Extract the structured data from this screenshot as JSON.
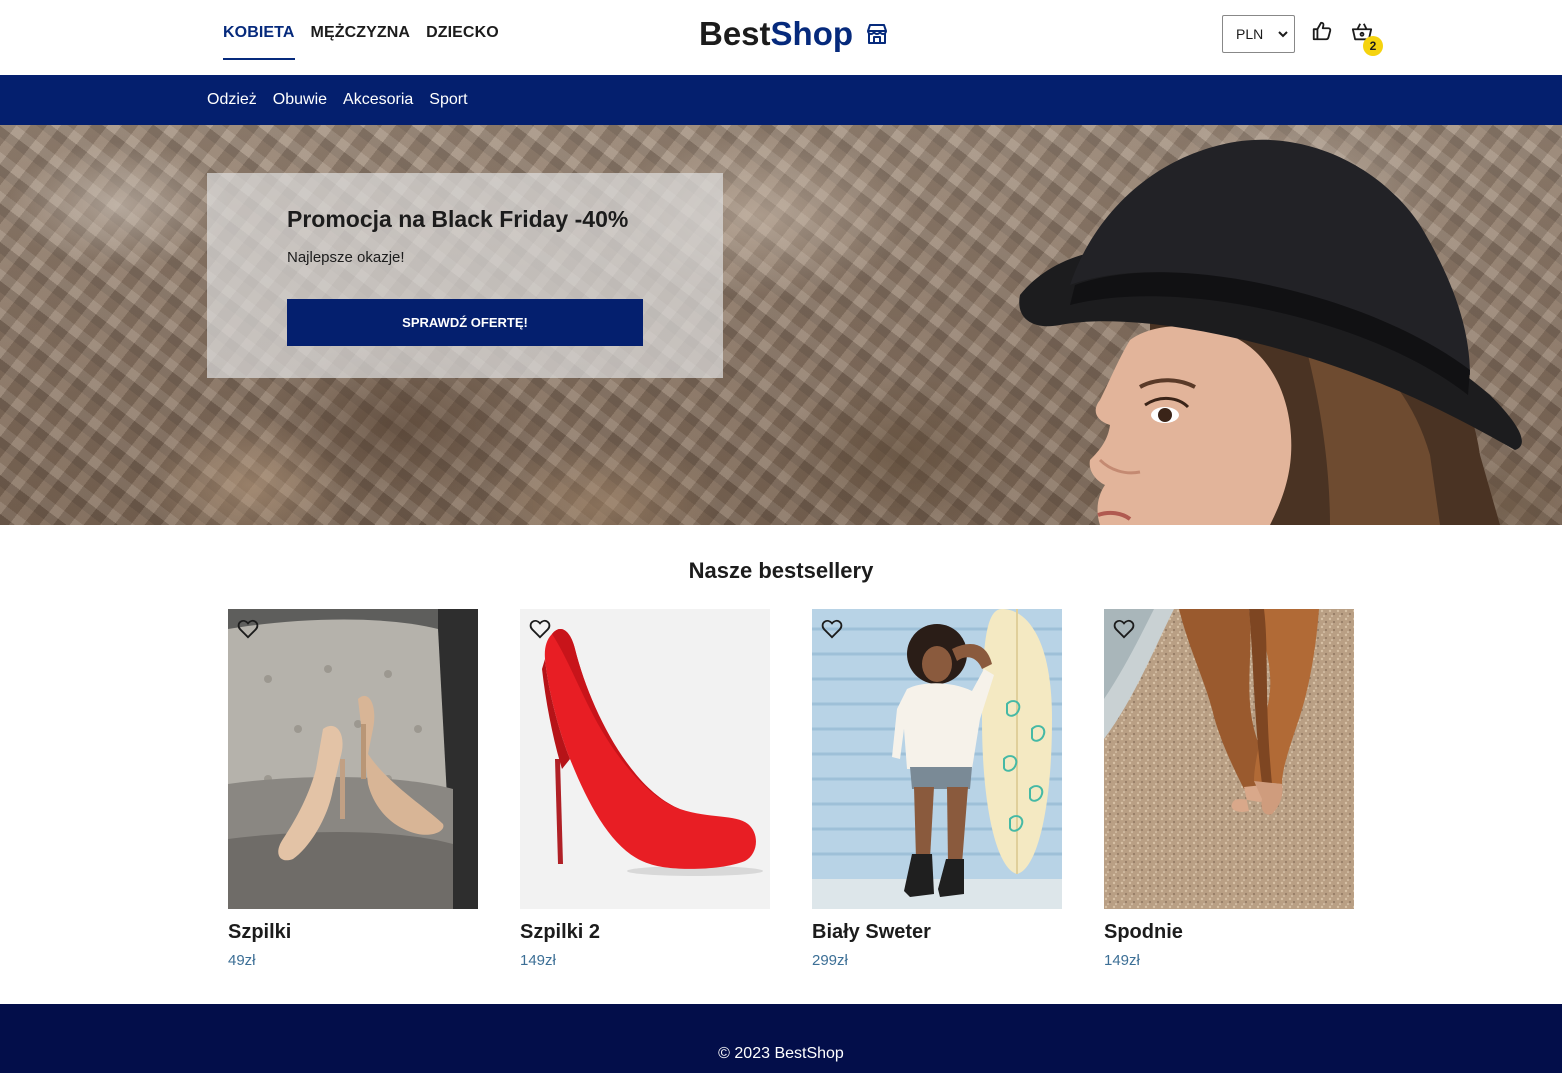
{
  "header": {
    "gender_nav": [
      {
        "label": "KOBIETA",
        "active": true
      },
      {
        "label": "MĘŻCZYZNA",
        "active": false
      },
      {
        "label": "DZIECKO",
        "active": false
      }
    ],
    "logo": {
      "part1": "Best",
      "part2": "Shop",
      "icon": "store-icon"
    },
    "currency": {
      "selected": "PLN"
    },
    "cart_count": "2",
    "icons": [
      "thumbs-up-icon",
      "basket-icon"
    ]
  },
  "category_nav": [
    "Odzież",
    "Obuwie",
    "Akcesoria",
    "Sport"
  ],
  "hero": {
    "title": "Promocja na Black Friday -40%",
    "subtitle": "Najlepsze okazje!",
    "button_label": "SPRAWDŹ OFERTĘ!"
  },
  "bestsellers": {
    "title": "Nasze bestsellery",
    "products": [
      {
        "name": "Szpilki",
        "price": "49zł"
      },
      {
        "name": "Szpilki 2",
        "price": "149zł"
      },
      {
        "name": "Biały Sweter",
        "price": "299zł"
      },
      {
        "name": "Spodnie",
        "price": "149zł"
      }
    ]
  },
  "footer": {
    "copyright": "© 2023 BestShop"
  },
  "colors": {
    "brand_navy": "#041f6e",
    "footer_navy": "#030e4a",
    "badge_yellow": "#f5d30f",
    "price_blue": "#3c6f96"
  }
}
